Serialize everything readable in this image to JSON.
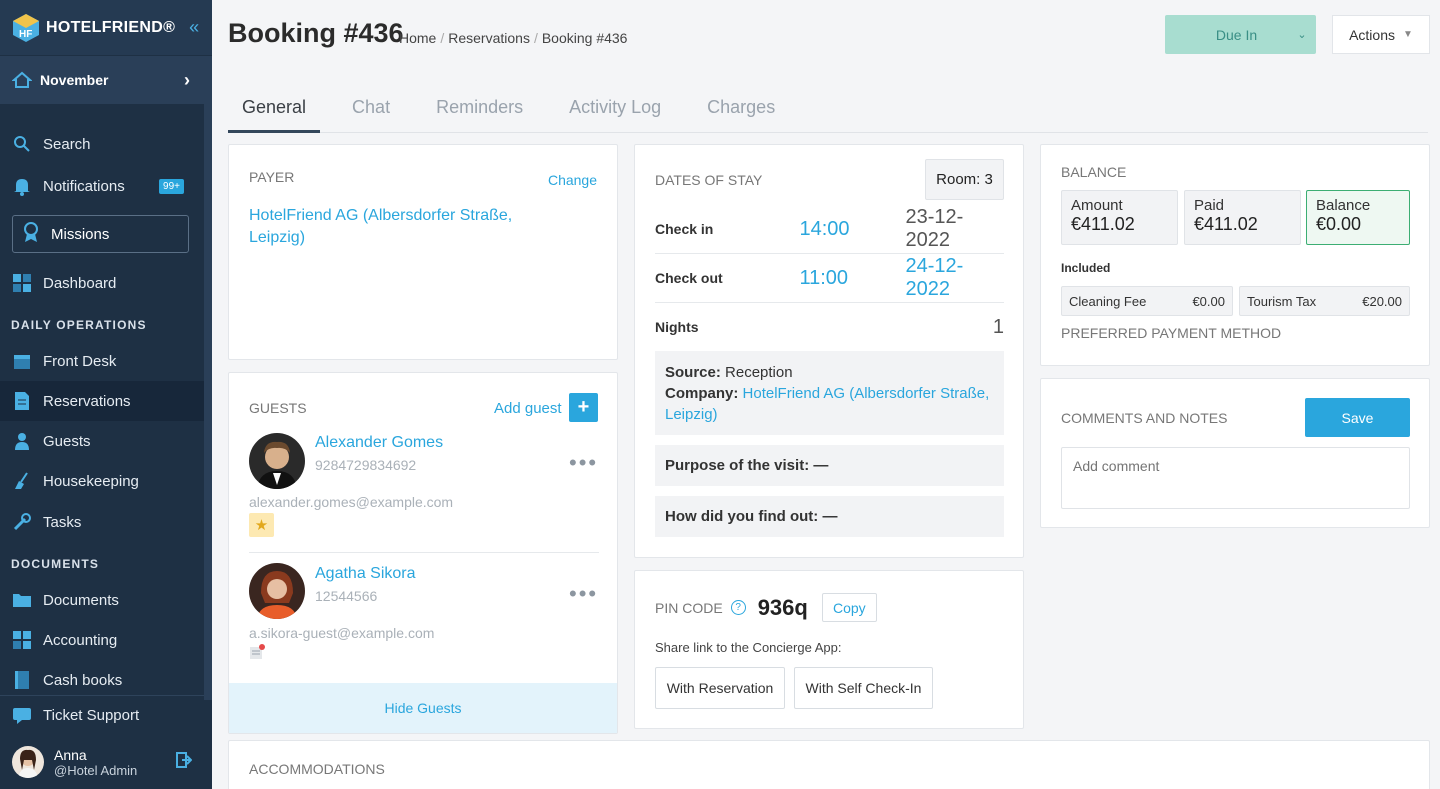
{
  "brand": {
    "name": "HOTELFRIEND®"
  },
  "month": {
    "label": "November"
  },
  "nav": {
    "search": "Search",
    "notifications": "Notifications",
    "notifications_badge": "99+",
    "missions": "Missions",
    "dashboard": "Dashboard",
    "section_daily": "DAILY OPERATIONS",
    "front_desk": "Front Desk",
    "reservations": "Reservations",
    "guests": "Guests",
    "housekeeping": "Housekeeping",
    "tasks": "Tasks",
    "section_documents": "DOCUMENTS",
    "documents": "Documents",
    "accounting": "Accounting",
    "cash_books": "Cash books",
    "ticket_support": "Ticket Support"
  },
  "user": {
    "name": "Anna",
    "role": "@Hotel Admin"
  },
  "header": {
    "title": "Booking #436",
    "breadcrumbs": [
      "Home",
      "Reservations",
      "Booking #436"
    ],
    "status_button": "Due In",
    "actions_button": "Actions"
  },
  "tabs": [
    "General",
    "Chat",
    "Reminders",
    "Activity Log",
    "Charges"
  ],
  "payer": {
    "label": "PAYER",
    "change": "Change",
    "name_line1": "HotelFriend AG (Albersdorfer Straße,",
    "name_line2": "Leipzig)"
  },
  "guests": {
    "label": "GUESTS",
    "add": "Add guest",
    "items": [
      {
        "name": "Alexander Gomes",
        "id": "9284729834692",
        "email": "alexander.gomes@example.com"
      },
      {
        "name": "Agatha Sikora",
        "id": "12544566",
        "email": "a.sikora-guest@example.com"
      }
    ],
    "hide": "Hide Guests"
  },
  "stay": {
    "label": "DATES OF STAY",
    "room": "Room: 3",
    "checkin_label": "Check in",
    "checkin_time": "14:00",
    "checkin_date": "23-12-2022",
    "checkout_label": "Check out",
    "checkout_time": "11:00",
    "checkout_date": "24-12-2022",
    "nights_label": "Nights",
    "nights": "1",
    "source_label": "Source:",
    "source": "Reception",
    "company_label": "Company:",
    "company_line1": "HotelFriend AG (Albersdorfer Straße,",
    "company_line2": "Leipzig)",
    "purpose": "Purpose of the visit: —",
    "find_out": "How did you find out: —"
  },
  "pin": {
    "label": "PIN CODE",
    "code": "936q",
    "copy": "Copy",
    "share": "Share link to the Concierge App:",
    "with_reservation": "With Reservation",
    "with_self_checkin": "With Self Check-In"
  },
  "balance": {
    "label": "BALANCE",
    "amount_label": "Amount",
    "amount": "€411.02",
    "paid_label": "Paid",
    "paid": "€411.02",
    "balance_label": "Balance",
    "balance": "€0.00",
    "included": "Included",
    "cleaning_label": "Cleaning Fee",
    "cleaning": "€0.00",
    "tourism_label": "Tourism Tax",
    "tourism": "€20.00",
    "preferred": "PREFERRED PAYMENT METHOD"
  },
  "comments": {
    "label": "COMMENTS AND NOTES",
    "save": "Save",
    "placeholder": "Add comment"
  },
  "accommodations": {
    "label": "ACCOMMODATIONS"
  }
}
